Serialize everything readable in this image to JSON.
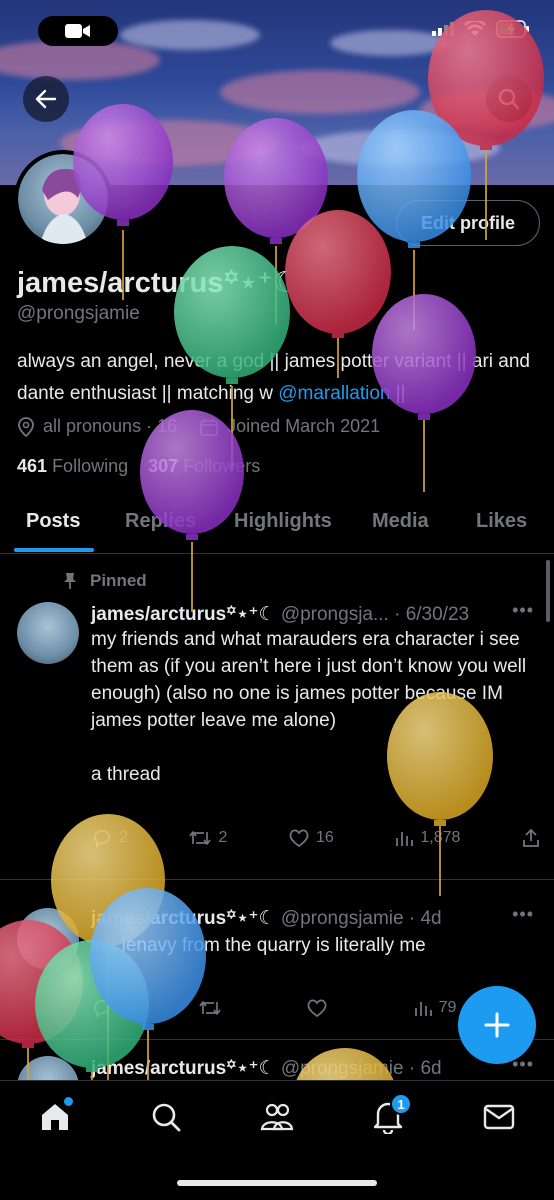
{
  "status_bar": {
    "camera_icon": "video-camera-icon",
    "signal_icon": "signal-icon",
    "wifi_icon": "wifi-icon",
    "battery_icon": "battery-charging-icon"
  },
  "profile": {
    "display_name": "james/arcturus꙳⋆⁺☾",
    "handle": "@prongsjamie",
    "bio_text": "always an angel, never a god || james potter variant || ari and dante enthusiast || matching w ",
    "bio_mention": "@marallation",
    "bio_end": " ||",
    "pronouns": "all pronouns · 16",
    "joined": "Joined March 2021",
    "following_count": "461",
    "following_label": "Following",
    "followers_count": "307",
    "followers_label": "Followers",
    "edit_label": "Edit profile"
  },
  "tabs": [
    {
      "label": "Posts"
    },
    {
      "label": "Replies"
    },
    {
      "label": "Highlights"
    },
    {
      "label": "Media"
    },
    {
      "label": "Likes"
    }
  ],
  "pinned_label": "Pinned",
  "posts": [
    {
      "name": "james/arcturus꙳⋆⁺☾",
      "handle_date": "@prongsja... · 6/30/23",
      "text": "my friends and what marauders era character i see them as (if you aren’t here i just don’t know you well enough) (also no one is james potter because IM james potter leave me alone)\n\na thread",
      "replies": "2",
      "reposts": "2",
      "likes": "16",
      "views": "1,878"
    },
    {
      "name": "james/arcturus꙳⋆⁺☾",
      "handle_date": "@prongsjamie · 4d",
      "text": "ian lenavy from the quarry is literally me",
      "replies": "",
      "reposts": "",
      "likes": "",
      "views": "79"
    },
    {
      "name": "james/arcturus꙳⋆⁺☾",
      "handle_date": "@prongsjamie · 6d"
    }
  ],
  "nav": {
    "notifications_badge": "1"
  },
  "colors": {
    "accent": "#1d9bf0",
    "background": "#000000",
    "muted": "#71767b"
  }
}
